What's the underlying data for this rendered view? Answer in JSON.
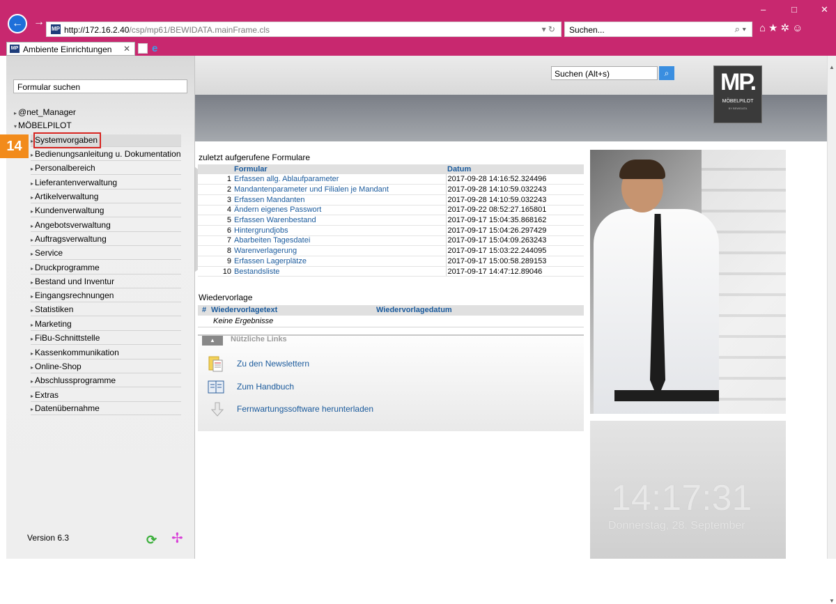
{
  "browser": {
    "url_host": "http://172.16.2.40",
    "url_path": "/csp/mp61/BEWIDATA.mainFrame.cls",
    "search_placeholder": "Suchen...",
    "tab_title": "Ambiente Einrichtungen",
    "mp_badge": "MP"
  },
  "sidebar": {
    "search_value": "Formular suchen",
    "top_items": [
      "@net_Manager",
      "MÖBELPILOT"
    ],
    "items": [
      "Systemvorgaben",
      "Bedienungsanleitung u. Dokumentation",
      "Personalbereich",
      "Lieferantenverwaltung",
      "Artikelverwaltung",
      "Kundenverwaltung",
      "Angebotsverwaltung",
      "Auftragsverwaltung",
      "Service",
      "Druckprogramme",
      "Bestand und Inventur",
      "Eingangsrechnungen",
      "Statistiken",
      "Marketing",
      "FiBu-Schnittstelle",
      "Kassenkommunikation",
      "Online-Shop",
      "Abschlussprogramme",
      "Extras",
      "Datenübernahme"
    ],
    "step_badge": "14",
    "version": "Version 6.3"
  },
  "header": {
    "search_value": "Suchen (Alt+s)",
    "logo_main": "MP.",
    "logo_sub": "MÖBELPILOT",
    "logo_tiny": "BY BEWIDATA"
  },
  "recent": {
    "title": "zuletzt aufgerufene Formulare",
    "col_form": "Formular",
    "col_date": "Datum",
    "rows": [
      {
        "n": "1",
        "form": "Erfassen allg. Ablaufparameter",
        "date": "2017-09-28 14:16:52.324496"
      },
      {
        "n": "2",
        "form": "Mandantenparameter und Filialen je Mandant",
        "date": "2017-09-28 14:10:59.032243"
      },
      {
        "n": "3",
        "form": "Erfassen Mandanten",
        "date": "2017-09-28 14:10:59.032243"
      },
      {
        "n": "4",
        "form": "Ändern eigenes Passwort",
        "date": "2017-09-22 08:52:27.165801"
      },
      {
        "n": "5",
        "form": "Erfassen Warenbestand",
        "date": "2017-09-17 15:04:35.868162"
      },
      {
        "n": "6",
        "form": "Hintergrundjobs",
        "date": "2017-09-17 15:04:26.297429"
      },
      {
        "n": "7",
        "form": "Abarbeiten Tagesdatei",
        "date": "2017-09-17 15:04:09.263243"
      },
      {
        "n": "8",
        "form": "Warenverlagerung",
        "date": "2017-09-17 15:03:22.244095"
      },
      {
        "n": "9",
        "form": "Erfassen Lagerplätze",
        "date": "2017-09-17 15:00:58.289153"
      },
      {
        "n": "10",
        "form": "Bestandsliste",
        "date": "2017-09-17 14:47:12.89046"
      }
    ]
  },
  "wiedervorlage": {
    "title": "Wiedervorlage",
    "col_hash": "#",
    "col_text": "Wiedervorlagetext",
    "col_date": "Wiedervorlagedatum",
    "empty": "Keine Ergebnisse"
  },
  "links": {
    "title": "Nützliche Links",
    "items": [
      "Zu den Newslettern",
      "Zum Handbuch",
      "Fernwartungssoftware herunterladen"
    ]
  },
  "clock": {
    "time": "14:17:31",
    "date": "Donnerstag, 28. September"
  }
}
